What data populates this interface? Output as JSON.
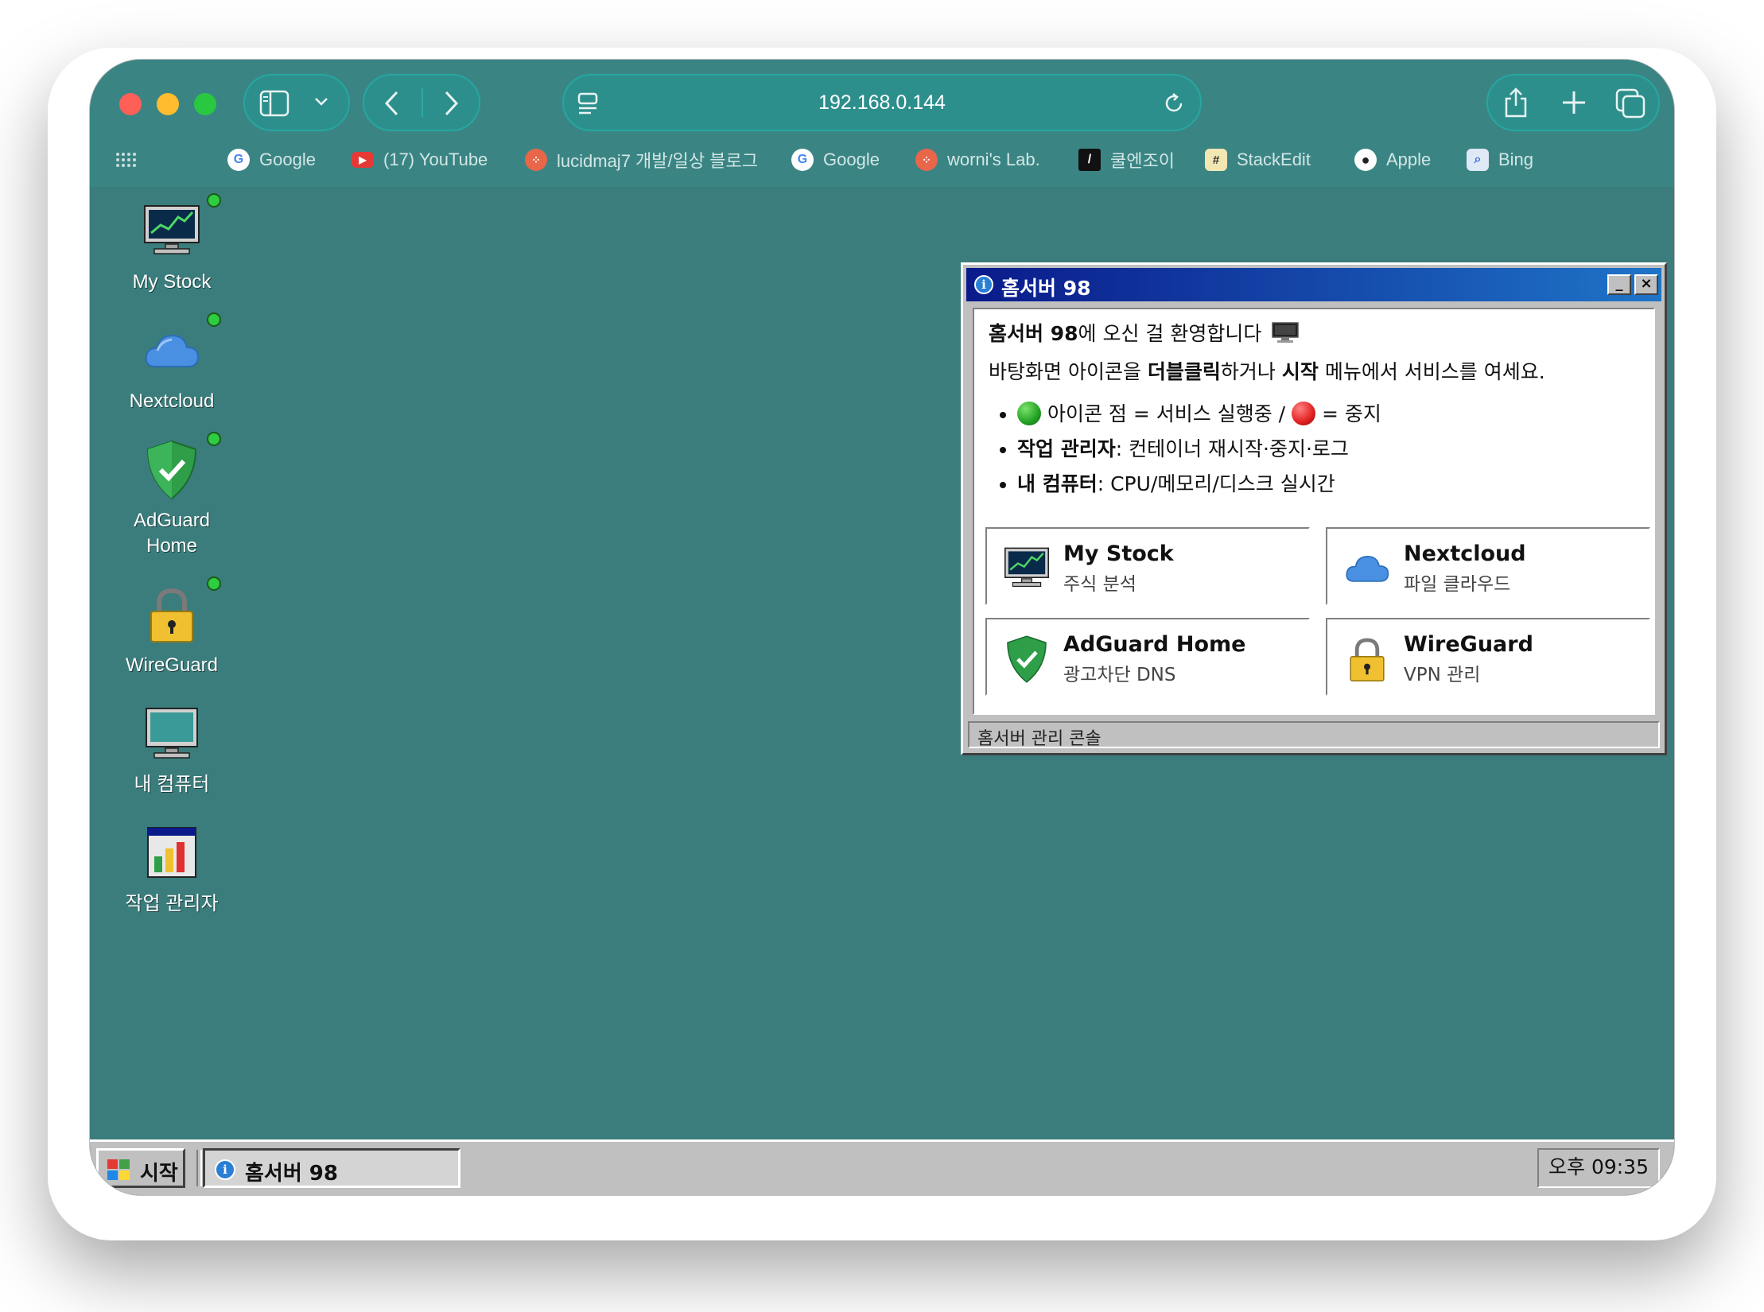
{
  "browser": {
    "url": "192.168.0.144",
    "bookmarks": [
      {
        "label": "Google",
        "icon": "google-icon"
      },
      {
        "label": "(17) YouTube",
        "icon": "youtube-icon"
      },
      {
        "label": "lucidmaj7 개발/일상 블로그",
        "icon": "tistory-icon"
      },
      {
        "label": "Google",
        "icon": "google-icon"
      },
      {
        "label": "worni's Lab.",
        "icon": "tistory-icon"
      },
      {
        "label": "쿨엔조이",
        "icon": "coolenjoy-icon"
      },
      {
        "label": "StackEdit",
        "icon": "stackedit-icon"
      },
      {
        "label": "Apple",
        "icon": "apple-icon"
      },
      {
        "label": "Bing",
        "icon": "bing-icon"
      }
    ]
  },
  "desktop": {
    "icons": [
      {
        "label": "My Stock",
        "status": "running"
      },
      {
        "label": "Nextcloud",
        "status": "running"
      },
      {
        "label": "AdGuard\nHome",
        "status": "running"
      },
      {
        "label": "WireGuard",
        "status": "running"
      },
      {
        "label": "내 컴퓨터"
      },
      {
        "label": "작업 관리자"
      }
    ]
  },
  "dialog": {
    "title": "홈서버 98",
    "welcome_bold": "홈서버 98",
    "welcome_rest": "에 오신 걸 환영합니다",
    "instr_pre": "바탕화면 아이콘을 ",
    "instr_b1": "더블클릭",
    "instr_mid": "하거나 ",
    "instr_b2": "시작",
    "instr_post": " 메뉴에서 서비스를 여세요.",
    "bullet1_a": "아이콘 점 = 서비스 실행중 /",
    "bullet1_b": "= 중지",
    "bullet2_bold": "작업 관리자",
    "bullet2_rest": ": 컨테이너 재시작·중지·로그",
    "bullet3_bold": "내 컴퓨터",
    "bullet3_rest": ": CPU/메모리/디스크 실시간",
    "services": [
      {
        "name": "My Stock",
        "desc": "주식 분석"
      },
      {
        "name": "Nextcloud",
        "desc": "파일 클라우드"
      },
      {
        "name": "AdGuard Home",
        "desc": "광고차단 DNS"
      },
      {
        "name": "WireGuard",
        "desc": "VPN 관리"
      }
    ],
    "status": "홈서버 관리 콘솔",
    "minimize": "_",
    "close": "×"
  },
  "taskbar": {
    "start": "시작",
    "task": "홈서버 98",
    "clock": "오후 09:35"
  },
  "colors": {
    "desktop": "#3a7d7c",
    "titlebar_start": "#0a1a8a",
    "titlebar_end": "#1f74c8",
    "running_dot": "#2ecc40"
  }
}
